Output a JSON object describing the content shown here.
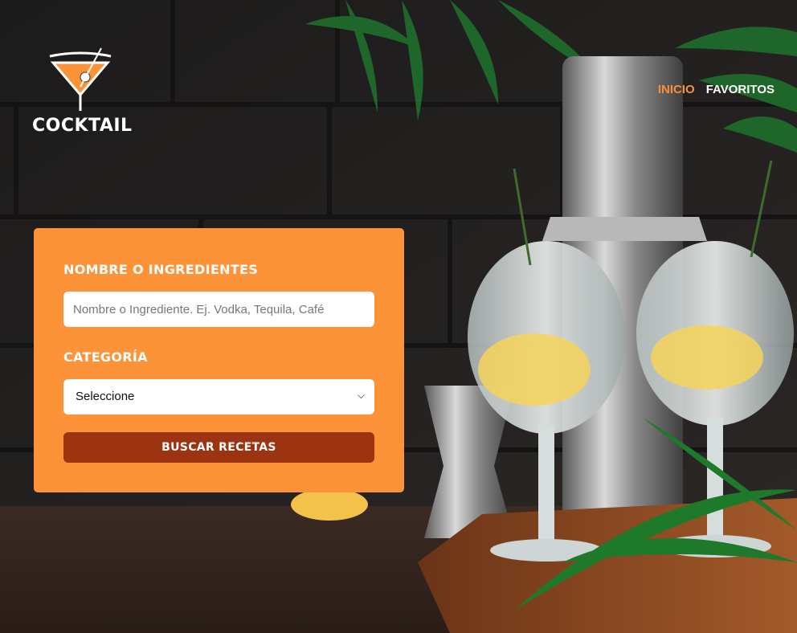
{
  "brand": {
    "name": "COCKTAIL",
    "logo_icon": "martini-glass-icon"
  },
  "nav": {
    "items": [
      {
        "label": "INICIO",
        "active": true
      },
      {
        "label": "FAVORITOS",
        "active": false
      }
    ]
  },
  "form": {
    "name_label": "NOMBRE O INGREDIENTES",
    "name_placeholder": "Nombre o Ingrediente. Ej. Vodka, Tequila, Café",
    "name_value": "",
    "category_label": "CATEGORÍA",
    "category_selected": "Seleccione",
    "submit_label": "BUSCAR RECETAS"
  },
  "colors": {
    "accent": "#fc9338",
    "button": "#9c3412",
    "nav_active": "#f6913a"
  },
  "hero": {
    "image_icon": "gin-tonic-cocktails-photo"
  }
}
